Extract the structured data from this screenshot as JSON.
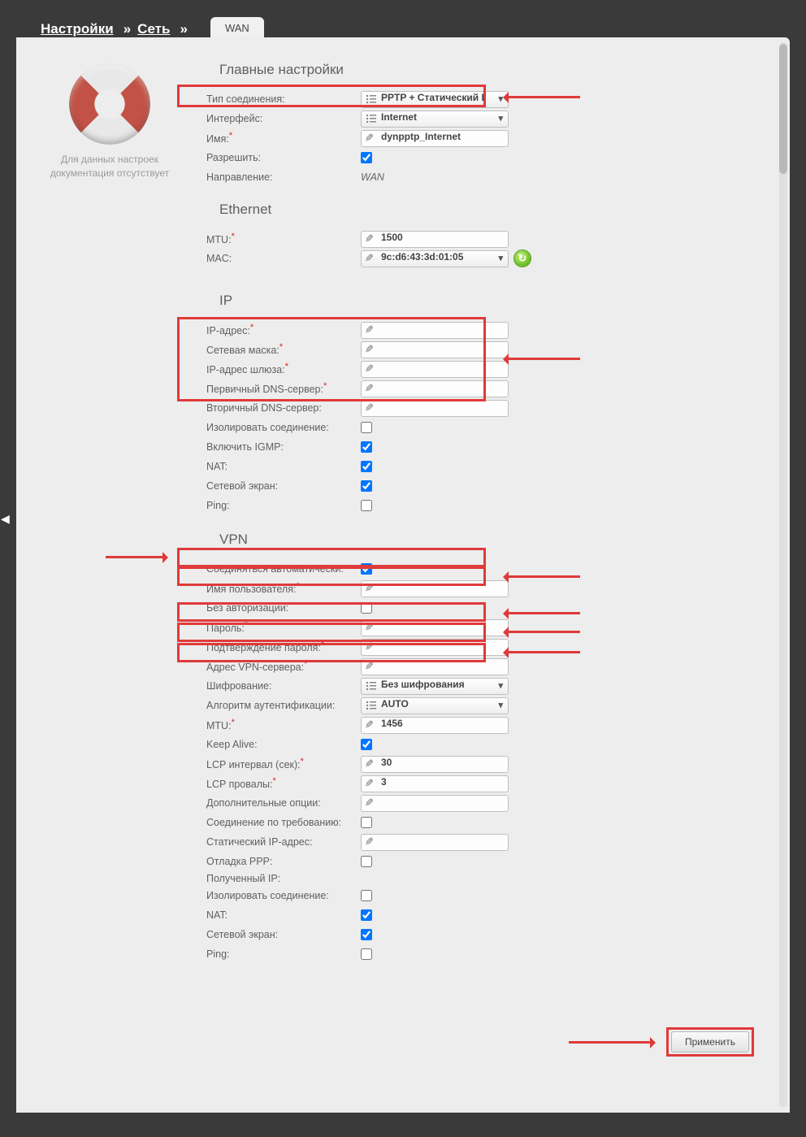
{
  "breadcrumb": {
    "settings": "Настройки",
    "net": "Сеть",
    "tab": "WAN",
    "sep": "»"
  },
  "help": {
    "line1": "Для данных настроек",
    "line2": "документация отсутствует"
  },
  "sections": {
    "main": "Главные настройки",
    "eth": "Ethernet",
    "ip": "IP",
    "vpn": "VPN"
  },
  "main": {
    "conn_type_label": "Тип соединения:",
    "conn_type_value": "PPTP + Статический I",
    "iface_label": "Интерфейс:",
    "iface_value": "Internet",
    "name_label": "Имя:",
    "name_value": "dynpptp_Internet",
    "allow_label": "Разрешить:",
    "allow_checked": true,
    "dir_label": "Направление:",
    "dir_value": "WAN"
  },
  "eth": {
    "mtu_label": "MTU:",
    "mtu_value": "1500",
    "mac_label": "MAC:",
    "mac_value": "9c:d6:43:3d:01:05"
  },
  "ip": {
    "addr_label": "IP-адрес:",
    "addr_value": "",
    "mask_label": "Сетевая маска:",
    "mask_value": "",
    "gw_label": "IP-адрес шлюза:",
    "gw_value": "",
    "dns1_label": "Первичный DNS-сервер:",
    "dns1_value": "",
    "dns2_label": "Вторичный DNS-сервер:",
    "dns2_value": "",
    "isol_label": "Изолировать соединение:",
    "igmp_label": "Включить IGMP:",
    "nat_label": "NAT:",
    "fw_label": "Сетевой экран:",
    "ping_label": "Ping:"
  },
  "vpn": {
    "auto_label": "Соединяться автоматически:",
    "user_label": "Имя пользователя:",
    "user_value": "",
    "noauth_label": "Без авторизации:",
    "pwd_label": "Пароль:",
    "pwd_value": "",
    "pwd2_label": "Подтверждение пароля:",
    "pwd2_value": "",
    "server_label": "Адрес VPN-сервера:",
    "server_value": "",
    "enc_label": "Шифрование:",
    "enc_value": "Без шифрования",
    "auth_label": "Алгоритм аутентификации:",
    "auth_value": "AUTO",
    "mtu_label": "MTU:",
    "mtu_value": "1456",
    "keep_label": "Keep Alive:",
    "lcp_int_label": "LCP интервал (сек):",
    "lcp_int_value": "30",
    "lcp_fail_label": "LCP провалы:",
    "lcp_fail_value": "3",
    "extra_label": "Дополнительные опции:",
    "extra_value": "",
    "demand_label": "Соединение по требованию:",
    "static_label": "Статический IP-адрес:",
    "static_value": "",
    "debug_label": "Отладка PPP:",
    "recv_label": "Полученный IP:",
    "isol_label": "Изолировать соединение:",
    "nat_label": "NAT:",
    "fw_label": "Сетевой экран:",
    "ping_label": "Ping:"
  },
  "footer": {
    "apply": "Применить"
  }
}
